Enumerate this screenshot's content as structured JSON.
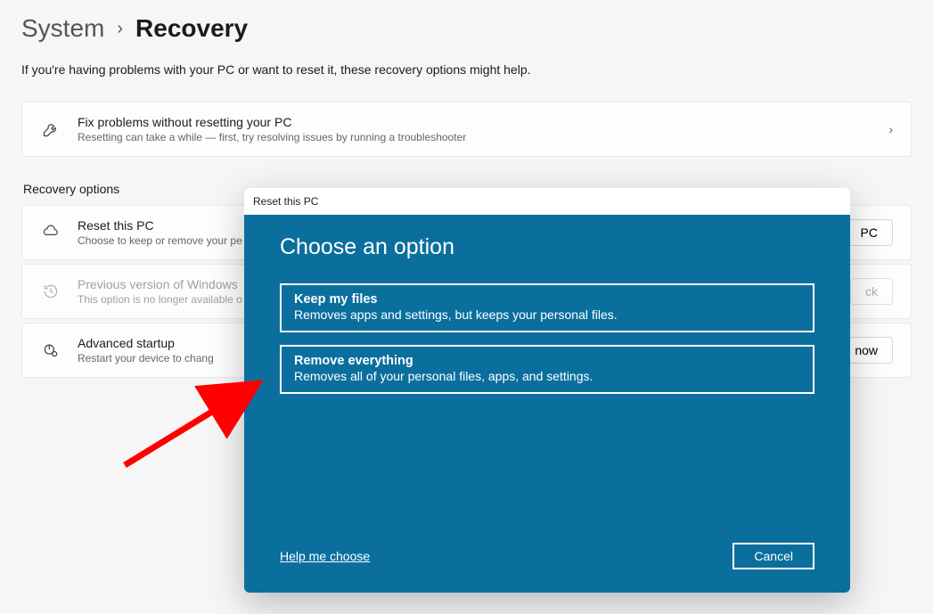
{
  "breadcrumb": {
    "parent": "System",
    "current": "Recovery"
  },
  "subtitle": "If you're having problems with your PC or want to reset it, these recovery options might help.",
  "fix_card": {
    "title": "Fix problems without resetting your PC",
    "desc": "Resetting can take a while — first, try resolving issues by running a troubleshooter"
  },
  "section_header": "Recovery options",
  "reset_card": {
    "title": "Reset this PC",
    "desc": "Choose to keep or remove your pe",
    "button": "PC"
  },
  "prev_card": {
    "title": "Previous version of Windows",
    "desc": "This option is no longer available o",
    "button": "ck"
  },
  "adv_card": {
    "title": "Advanced startup",
    "desc": "Restart your device to chang",
    "button": "now"
  },
  "dialog": {
    "titlebar": "Reset this PC",
    "heading": "Choose an option",
    "options": [
      {
        "title": "Keep my files",
        "desc": "Removes apps and settings, but keeps your personal files."
      },
      {
        "title": "Remove everything",
        "desc": "Removes all of your personal files, apps, and settings."
      }
    ],
    "help": "Help me choose",
    "cancel": "Cancel"
  }
}
